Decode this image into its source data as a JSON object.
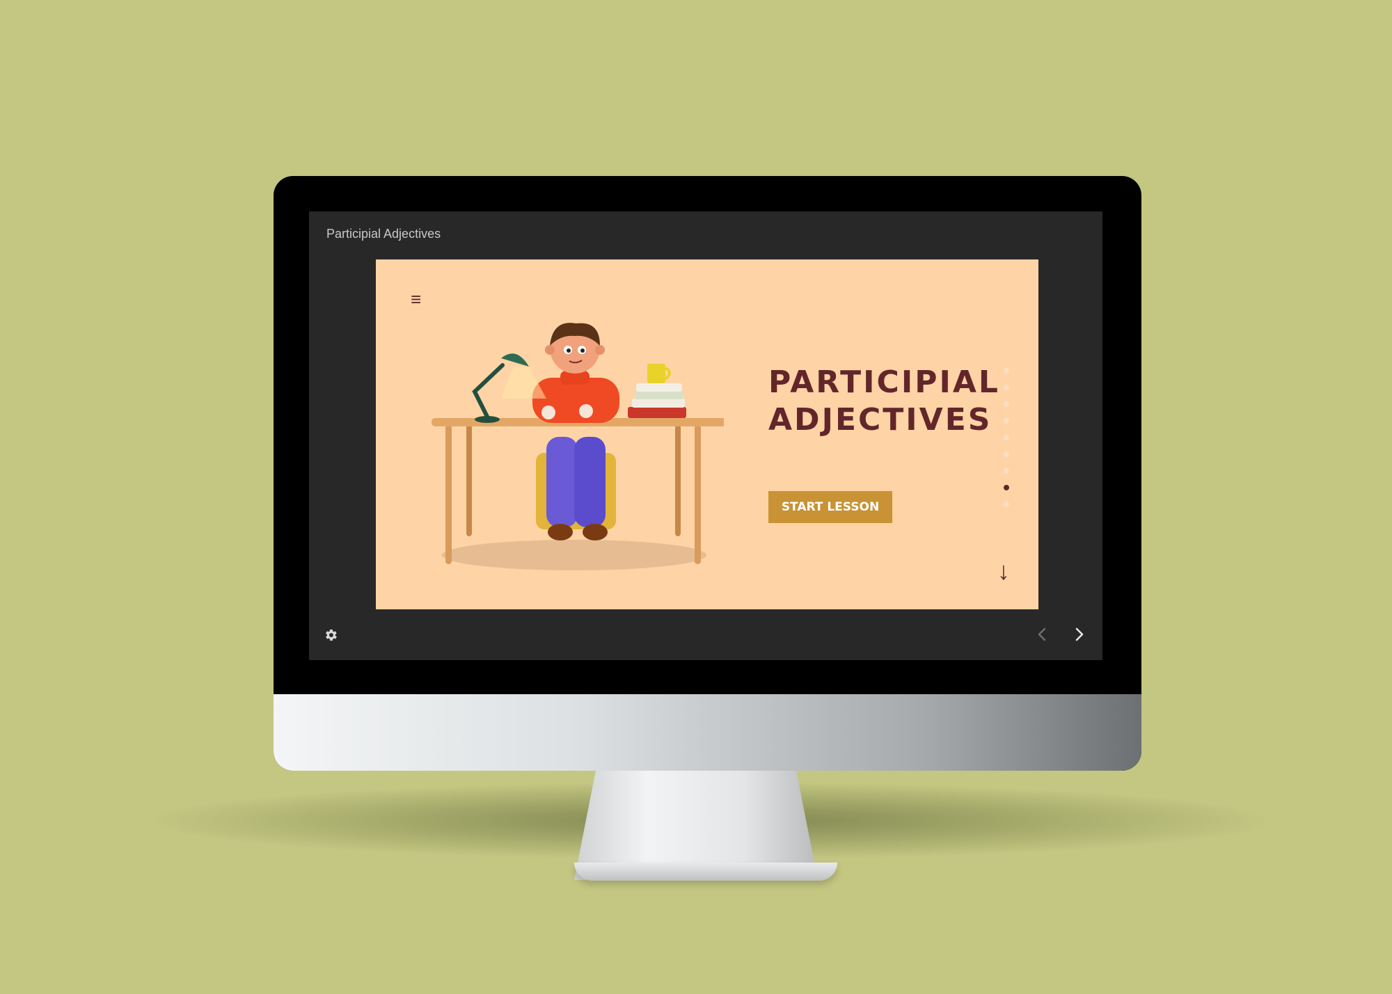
{
  "app": {
    "title": "Participial Adjectives"
  },
  "slide": {
    "heading_line1": "PARTICIPIAL",
    "heading_line2": "ADJECTIVES",
    "start_button": "START LESSON",
    "menu_icon": "≡",
    "scroll_down_icon": "↓",
    "progress": {
      "total_dots": 9,
      "active_index": 7
    }
  },
  "controls": {
    "settings": "gear-icon",
    "prev": "chevron-left-icon",
    "next": "chevron-right-icon"
  },
  "colors": {
    "background": "#c4c782",
    "screen": "#282828",
    "slide_background": "#fed4a6",
    "heading": "#62262a",
    "button": "#c99234"
  }
}
